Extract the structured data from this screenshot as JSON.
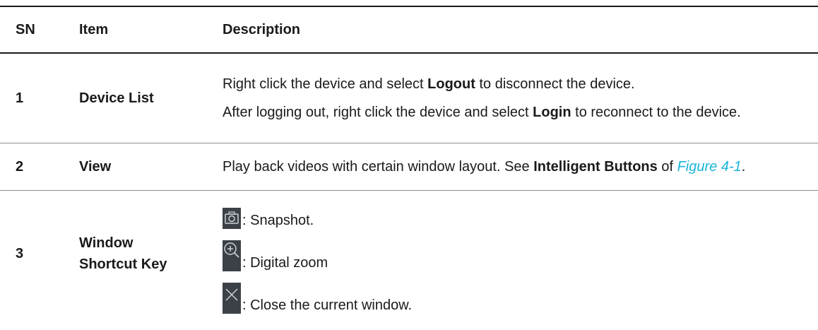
{
  "table": {
    "headers": {
      "sn": "SN",
      "item": "Item",
      "description": "Description"
    },
    "rows": [
      {
        "sn": "1",
        "item": "Device List",
        "desc_1": {
          "pre": "Right click the device and select ",
          "bold": "Logout",
          "post": " to disconnect the device."
        },
        "desc_2": {
          "pre": "After logging out, right click the device and select ",
          "bold": "Login",
          "post": " to reconnect to the device."
        }
      },
      {
        "sn": "2",
        "item": "View",
        "desc": {
          "pre": "Play back videos with certain window layout. See ",
          "bold": "Intelligent Buttons",
          "mid": " of ",
          "link": "Figure 4-1",
          "post": "."
        }
      },
      {
        "sn": "3",
        "item_line1": "Window",
        "item_line2": "Shortcut Key",
        "keys": [
          {
            "icon": "camera-icon",
            "text": ": Snapshot."
          },
          {
            "icon": "zoom-in-icon",
            "text": ": Digital zoom"
          },
          {
            "icon": "close-icon",
            "text": ": Close the current window."
          }
        ]
      }
    ]
  },
  "colors": {
    "link": "#19b5d8",
    "icon_background": "#3b4147"
  }
}
